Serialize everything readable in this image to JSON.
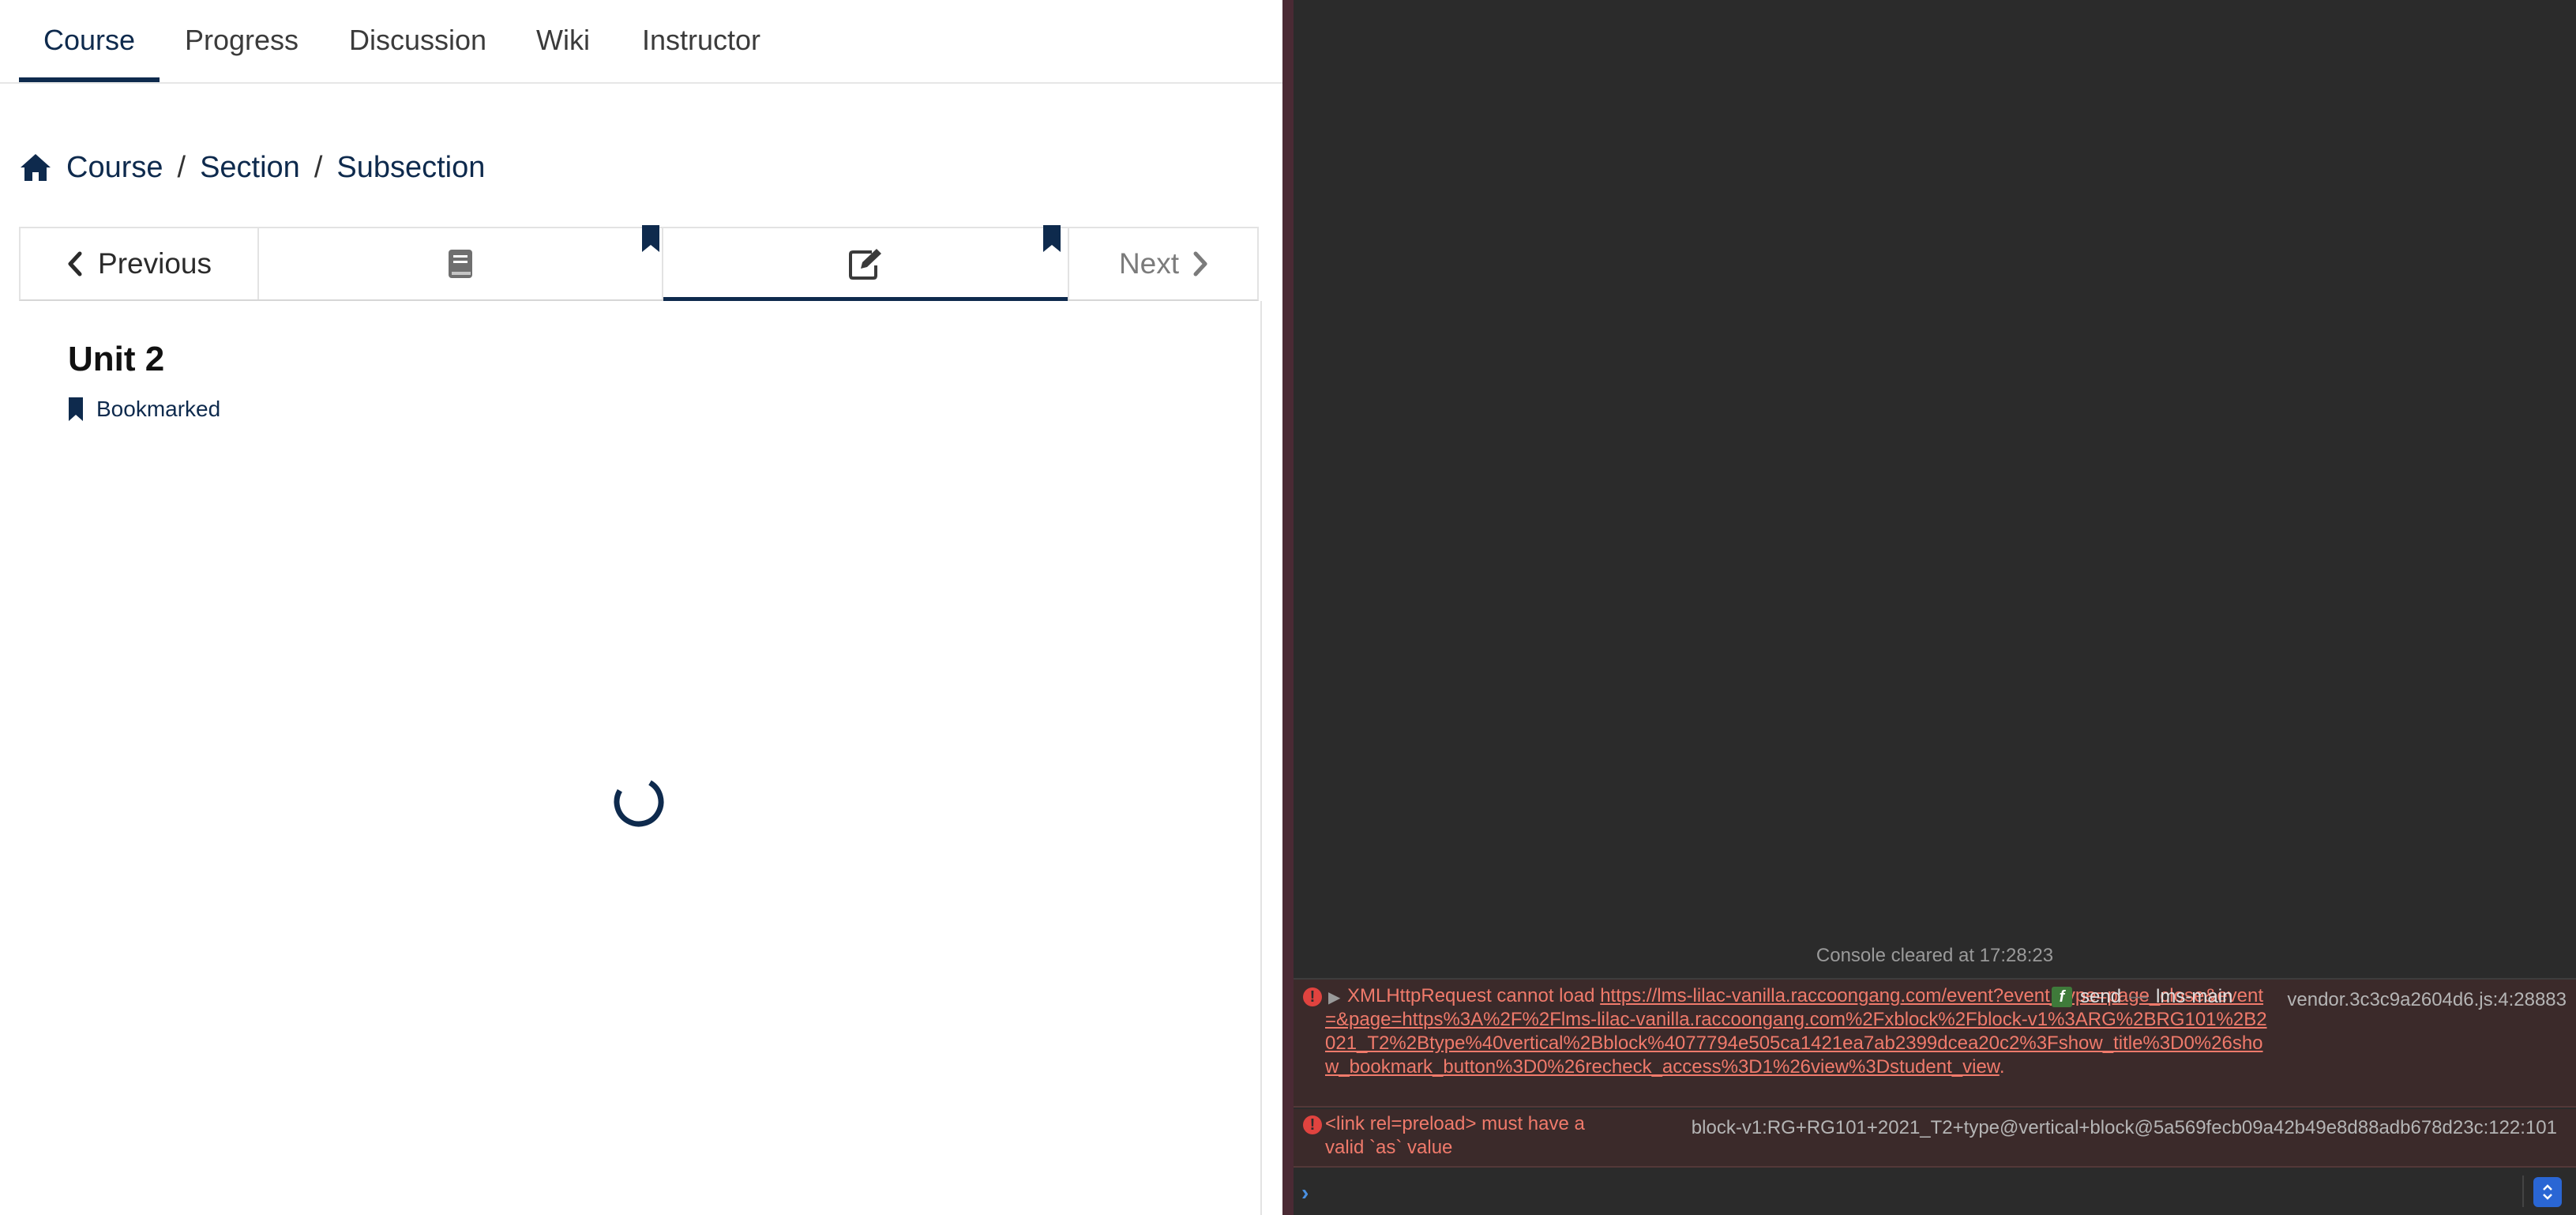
{
  "course_tabs": [
    "Course",
    "Progress",
    "Discussion",
    "Wiki",
    "Instructor"
  ],
  "breadcrumb": {
    "items": [
      "Course",
      "Section",
      "Subsection"
    ],
    "separator": "/"
  },
  "unit_nav": {
    "previous_label": "Previous",
    "next_label": "Next"
  },
  "unit": {
    "title": "Unit 2",
    "bookmark_label": "Bookmarked"
  },
  "console": {
    "cleared_message": "Console cleared at 17:28:23",
    "errors": [
      {
        "prefix": "XMLHttpRequest cannot load",
        "url": "https://lms-lilac-vanilla.raccoongang.com/event?event_type=page_close&event=&page=https%3A%2F%2Flms-lilac-vanilla.raccoongang.com%2Fxblock%2Fblock-v1%3ARG%2BRG101%2B2021_T2%2Btype%40vertical%2Bblock%4077794e505ca1421ea7ab2399dcea20c2%3Fshow_title%3D0%26show_bookmark_button%3D0%26recheck_access%3D1%26view%3Dstudent_view",
        "suffix": ".",
        "function": "send",
        "context": "lms-main",
        "source": "vendor.3c3c9a2604d6.js:4:28883"
      },
      {
        "message": "<link rel=preload> must have a valid `as` value",
        "source": "block-v1:RG+RG101+2021_T2+type@vertical+block@5a569fecb09a42b49e8d88adb678d23c:122:101"
      }
    ]
  },
  "colors": {
    "primary": "#0e2a4d",
    "error_text": "#f07a6b",
    "console_bg": "#2b2b2b"
  }
}
